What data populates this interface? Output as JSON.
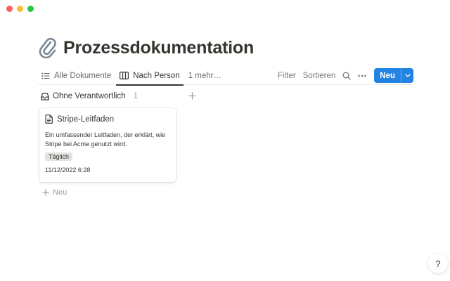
{
  "page": {
    "title": "Prozessdokumentation",
    "title_icon": "paperclip-icon"
  },
  "views": [
    {
      "label": "Alle Dokumente",
      "icon": "list-icon",
      "active": false
    },
    {
      "label": "Nach Person",
      "icon": "board-icon",
      "active": true
    },
    {
      "label": "1 mehr…",
      "active": false
    }
  ],
  "toolbar": {
    "filter_label": "Filter",
    "sort_label": "Sortieren",
    "search_icon": "search-icon",
    "more_icon": "more-icon",
    "new_label": "Neu"
  },
  "group": {
    "name": "Ohne Verantwortlich",
    "count": "1",
    "icon": "inbox-icon"
  },
  "card": {
    "title": "Stripe-Leitfaden",
    "description": "Ein umfassender Leitfaden, der erklärt, wie Stripe bei Acme genutzt wird.",
    "tag": "Täglich",
    "date": "11/12/2022 6:28"
  },
  "add_card_label": "Neu",
  "help_label": "?",
  "colors": {
    "accent": "#2383e2",
    "tag_bg": "#e3e2e0",
    "text": "#37352f"
  }
}
